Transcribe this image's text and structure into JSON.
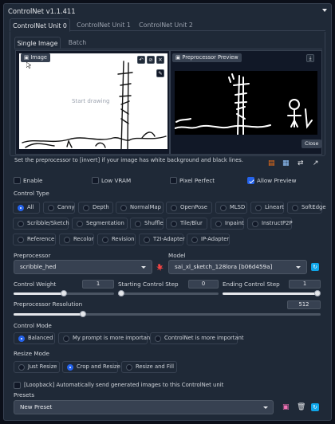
{
  "header": {
    "title": "ControlNet v1.1.411"
  },
  "tabs": [
    "ControlNet Unit 0",
    "ControlNet Unit 1",
    "ControlNet Unit 2"
  ],
  "subtabs": [
    "Single Image",
    "Batch"
  ],
  "image_panel": {
    "label": "Image",
    "placeholder": "Start drawing"
  },
  "preview_panel": {
    "label": "Preprocessor Preview",
    "close": "Close"
  },
  "hint": "Set the preprocessor to [invert] if your image has white background and black lines.",
  "checks": {
    "enable": "Enable",
    "low_vram": "Low VRAM",
    "pixel_perfect": "Pixel Perfect",
    "allow_preview": "Allow Preview"
  },
  "control_type": {
    "label": "Control Type",
    "options": [
      "All",
      "Canny",
      "Depth",
      "NormalMap",
      "OpenPose",
      "MLSD",
      "Lineart",
      "SoftEdge",
      "Scribble/Sketch",
      "Segmentation",
      "Shuffle",
      "Tile/Blur",
      "Inpaint",
      "InstructP2P",
      "Reference",
      "Recolor",
      "Revision",
      "T2I-Adapter",
      "IP-Adapter"
    ],
    "selected": "All"
  },
  "preprocessor": {
    "label": "Preprocessor",
    "value": "scribble_hed"
  },
  "model": {
    "label": "Model",
    "value": "sai_xl_sketch_128lora [b06d459a]"
  },
  "sliders": {
    "control_weight": {
      "label": "Control Weight",
      "value": "1",
      "level": 0.5
    },
    "start_step": {
      "label": "Starting Control Step",
      "value": "0",
      "level": 0.0
    },
    "end_step": {
      "label": "Ending Control Step",
      "value": "1",
      "level": 1.0
    },
    "resolution": {
      "label": "Preprocessor Resolution",
      "value": "512",
      "level": 0.22
    }
  },
  "control_mode": {
    "label": "Control Mode",
    "options": [
      "Balanced",
      "My prompt is more important",
      "ControlNet is more important"
    ],
    "selected": "Balanced"
  },
  "resize_mode": {
    "label": "Resize Mode",
    "options": [
      "Just Resize",
      "Crop and Resize",
      "Resize and Fill"
    ],
    "selected": "Crop and Resize"
  },
  "loopback": "[Loopback] Automatically send generated images to this ControlNet unit",
  "presets": {
    "label": "Presets",
    "value": "New Preset"
  },
  "colors": {
    "accent": "#2563eb",
    "background": "#0b0f19",
    "panel": "#1f2937"
  }
}
